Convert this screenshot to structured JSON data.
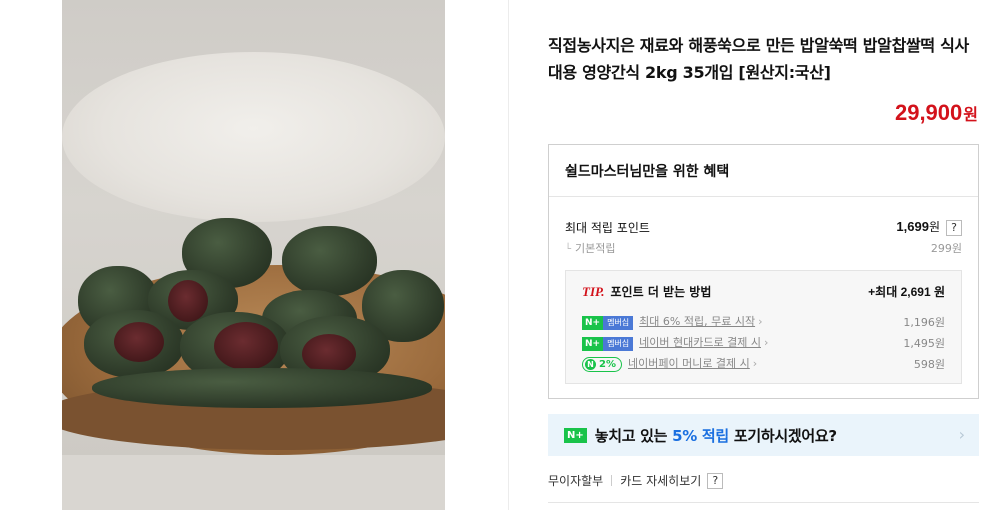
{
  "product": {
    "title": "직접농사지은 재료와 해풍쑥으로 만든 밥알쑥떡 밥알찹쌀떡 식사대용 영양간식 2kg 35개입 [원산지:국산]",
    "price": "29,900",
    "price_unit": "원"
  },
  "benefit": {
    "heading": "쉴드마스터님만을 위한 혜택",
    "max_points_label": "최대 적립 포인트",
    "max_points_value": "1,699",
    "max_points_unit": "원",
    "help_label": "?",
    "basic_label": "기본적립",
    "basic_value": "299원",
    "tip": {
      "tip_label": "TIP.",
      "title": "포인트 더 받는 방법",
      "max_text": "+최대 2,691 원",
      "rows": [
        {
          "badge_n": "N+",
          "badge_label": "멤버십",
          "label": "최대 6% 적립, 무료 시작",
          "value": "1,196원"
        },
        {
          "badge_n": "N+",
          "badge_label": "멤버십",
          "label": "네이버 현대카드로 결제 시",
          "value": "1,495원"
        },
        {
          "badge_pay": "2%",
          "badge_icon": "N",
          "label": "네이버페이 머니로 결제 시",
          "value": "598원"
        }
      ]
    }
  },
  "promo": {
    "badge": "N+",
    "text_before": "놓치고 있는 ",
    "highlight": "5% 적립",
    "text_after": " 포기하시겠어요?"
  },
  "bottom_links": {
    "installment": "무이자할부",
    "card_detail": "카드 자세히보기",
    "help": "?"
  },
  "colors": {
    "price": "#d3121b",
    "naver_green": "#19c34a",
    "membership_blue": "#4b79d6",
    "promo_highlight": "#1a6fe0",
    "promo_bg": "#eaf4fb"
  },
  "icons": {
    "chevron": "chevron-right-icon",
    "help": "help-icon"
  }
}
